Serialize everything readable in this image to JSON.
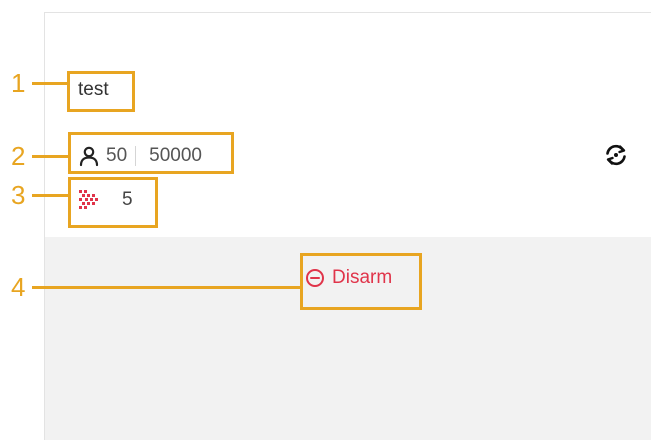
{
  "callouts": [
    "1",
    "2",
    "3",
    "4"
  ],
  "device": {
    "name": "test",
    "range_min": "50",
    "range_max": "50000",
    "count": "5"
  },
  "actions": {
    "disarm_label": "Disarm"
  },
  "icons": {
    "user": "user-icon",
    "sync": "sync-icon",
    "dots": "dots-arrow-icon",
    "disarm": "minus-circle-icon"
  },
  "colors": {
    "annotation": "#e8a521",
    "danger": "#e0344a",
    "footer_bg": "#f2f2f2"
  }
}
